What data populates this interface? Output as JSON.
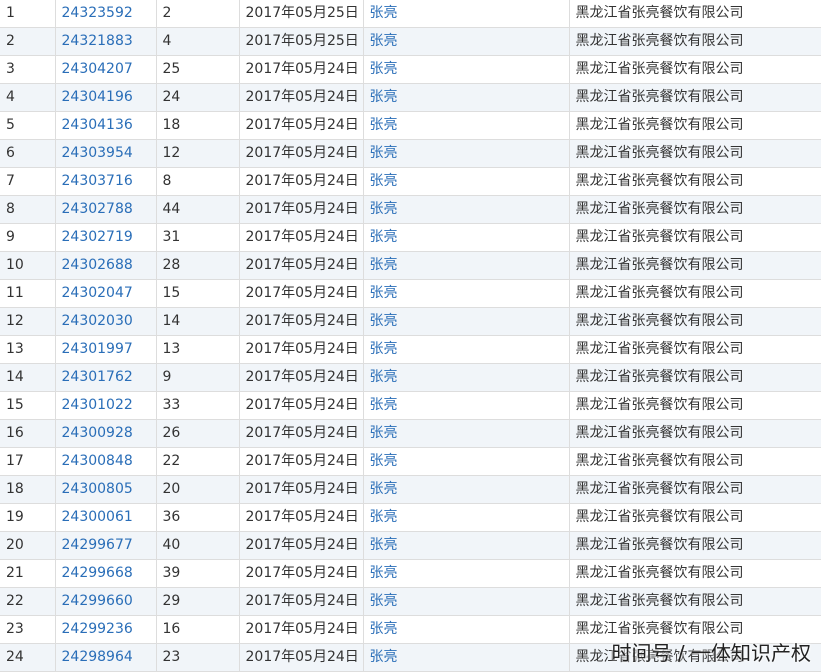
{
  "rows": [
    {
      "no": "1",
      "reg": "24323592",
      "cls": "2",
      "date": "2017年05月25日",
      "applicant": "张亮",
      "company": "黑龙江省张亮餐饮有限公司"
    },
    {
      "no": "2",
      "reg": "24321883",
      "cls": "4",
      "date": "2017年05月25日",
      "applicant": "张亮",
      "company": "黑龙江省张亮餐饮有限公司"
    },
    {
      "no": "3",
      "reg": "24304207",
      "cls": "25",
      "date": "2017年05月24日",
      "applicant": "张亮",
      "company": "黑龙江省张亮餐饮有限公司"
    },
    {
      "no": "4",
      "reg": "24304196",
      "cls": "24",
      "date": "2017年05月24日",
      "applicant": "张亮",
      "company": "黑龙江省张亮餐饮有限公司"
    },
    {
      "no": "5",
      "reg": "24304136",
      "cls": "18",
      "date": "2017年05月24日",
      "applicant": "张亮",
      "company": "黑龙江省张亮餐饮有限公司"
    },
    {
      "no": "6",
      "reg": "24303954",
      "cls": "12",
      "date": "2017年05月24日",
      "applicant": "张亮",
      "company": "黑龙江省张亮餐饮有限公司"
    },
    {
      "no": "7",
      "reg": "24303716",
      "cls": "8",
      "date": "2017年05月24日",
      "applicant": "张亮",
      "company": "黑龙江省张亮餐饮有限公司"
    },
    {
      "no": "8",
      "reg": "24302788",
      "cls": "44",
      "date": "2017年05月24日",
      "applicant": "张亮",
      "company": "黑龙江省张亮餐饮有限公司"
    },
    {
      "no": "9",
      "reg": "24302719",
      "cls": "31",
      "date": "2017年05月24日",
      "applicant": "张亮",
      "company": "黑龙江省张亮餐饮有限公司"
    },
    {
      "no": "10",
      "reg": "24302688",
      "cls": "28",
      "date": "2017年05月24日",
      "applicant": "张亮",
      "company": "黑龙江省张亮餐饮有限公司"
    },
    {
      "no": "11",
      "reg": "24302047",
      "cls": "15",
      "date": "2017年05月24日",
      "applicant": "张亮",
      "company": "黑龙江省张亮餐饮有限公司"
    },
    {
      "no": "12",
      "reg": "24302030",
      "cls": "14",
      "date": "2017年05月24日",
      "applicant": "张亮",
      "company": "黑龙江省张亮餐饮有限公司"
    },
    {
      "no": "13",
      "reg": "24301997",
      "cls": "13",
      "date": "2017年05月24日",
      "applicant": "张亮",
      "company": "黑龙江省张亮餐饮有限公司"
    },
    {
      "no": "14",
      "reg": "24301762",
      "cls": "9",
      "date": "2017年05月24日",
      "applicant": "张亮",
      "company": "黑龙江省张亮餐饮有限公司"
    },
    {
      "no": "15",
      "reg": "24301022",
      "cls": "33",
      "date": "2017年05月24日",
      "applicant": "张亮",
      "company": "黑龙江省张亮餐饮有限公司"
    },
    {
      "no": "16",
      "reg": "24300928",
      "cls": "26",
      "date": "2017年05月24日",
      "applicant": "张亮",
      "company": "黑龙江省张亮餐饮有限公司"
    },
    {
      "no": "17",
      "reg": "24300848",
      "cls": "22",
      "date": "2017年05月24日",
      "applicant": "张亮",
      "company": "黑龙江省张亮餐饮有限公司"
    },
    {
      "no": "18",
      "reg": "24300805",
      "cls": "20",
      "date": "2017年05月24日",
      "applicant": "张亮",
      "company": "黑龙江省张亮餐饮有限公司"
    },
    {
      "no": "19",
      "reg": "24300061",
      "cls": "36",
      "date": "2017年05月24日",
      "applicant": "张亮",
      "company": "黑龙江省张亮餐饮有限公司"
    },
    {
      "no": "20",
      "reg": "24299677",
      "cls": "40",
      "date": "2017年05月24日",
      "applicant": "张亮",
      "company": "黑龙江省张亮餐饮有限公司"
    },
    {
      "no": "21",
      "reg": "24299668",
      "cls": "39",
      "date": "2017年05月24日",
      "applicant": "张亮",
      "company": "黑龙江省张亮餐饮有限公司"
    },
    {
      "no": "22",
      "reg": "24299660",
      "cls": "29",
      "date": "2017年05月24日",
      "applicant": "张亮",
      "company": "黑龙江省张亮餐饮有限公司"
    },
    {
      "no": "23",
      "reg": "24299236",
      "cls": "16",
      "date": "2017年05月24日",
      "applicant": "张亮",
      "company": "黑龙江省张亮餐饮有限公司"
    },
    {
      "no": "24",
      "reg": "24298964",
      "cls": "23",
      "date": "2017年05月24日",
      "applicant": "张亮",
      "company": "黑龙江省张亮餐饮有限公司"
    }
  ],
  "watermark": "时间号 / 一体知识产权",
  "colors": {
    "link": "#2a6eb8",
    "stripe": "#f1f5f9",
    "border": "#dddddd",
    "text": "#333333"
  }
}
